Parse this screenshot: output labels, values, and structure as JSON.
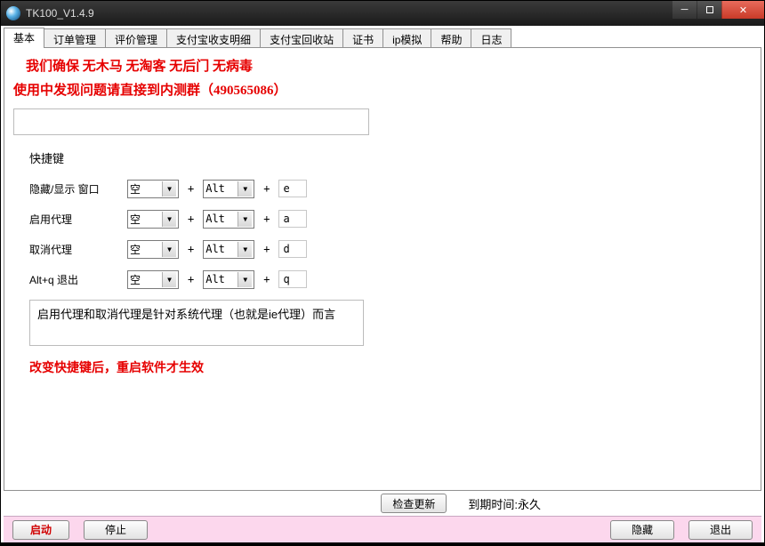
{
  "title": "TK100_V1.4.9",
  "tabs": [
    "基本",
    "订单管理",
    "评价管理",
    "支付宝收支明细",
    "支付宝回收站",
    "证书",
    "ip模拟",
    "帮助",
    "日志"
  ],
  "activeTabIndex": 0,
  "banner": {
    "line1": "我们确保  无木马  无淘客 无后门  无病毒",
    "line2": "使用中发现问题请直接到内测群（490565086）"
  },
  "hotkeys": {
    "title": "快捷键",
    "rows": [
      {
        "label": "隐藏/显示 窗口",
        "mod1": "空",
        "mod2": "Alt",
        "key": "e"
      },
      {
        "label": "启用代理",
        "mod1": "空",
        "mod2": "Alt",
        "key": "a"
      },
      {
        "label": "取消代理",
        "mod1": "空",
        "mod2": "Alt",
        "key": "d"
      },
      {
        "label": "Alt+q  退出",
        "mod1": "空",
        "mod2": "Alt",
        "key": "q"
      }
    ],
    "plus": "+",
    "note": "启用代理和取消代理是针对系统代理（也就是ie代理）而言",
    "warn": "改变快捷键后，重启软件才生效"
  },
  "midbar": {
    "checkUpdate": "检查更新",
    "expire": "到期时间:永久"
  },
  "bottombar": {
    "start": "启动",
    "stop": "停止",
    "hide": "隐藏",
    "exit": "退出"
  }
}
